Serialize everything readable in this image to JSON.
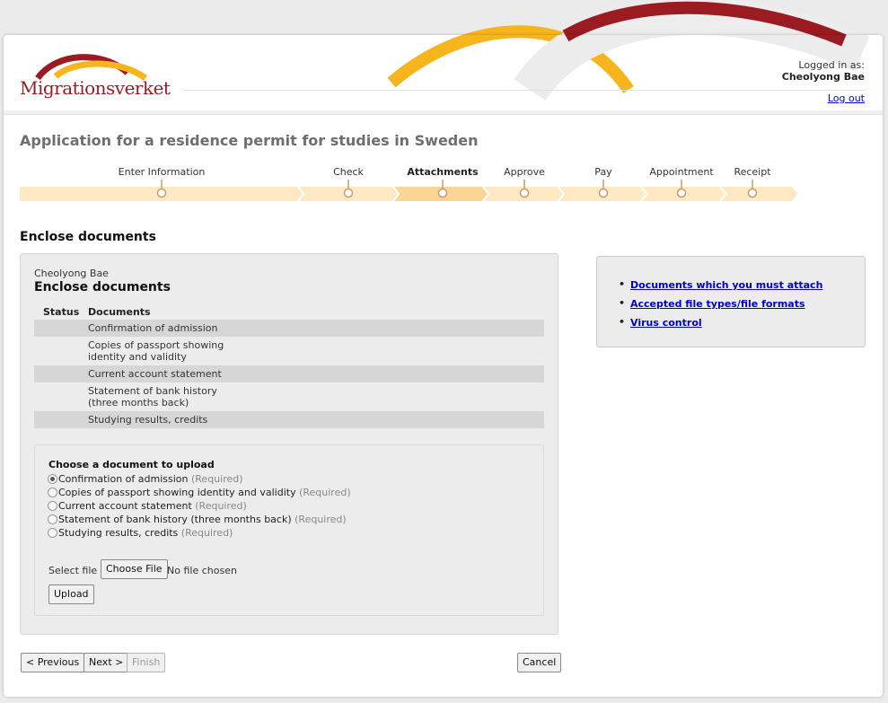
{
  "header": {
    "logo_text": "Migrationsverket",
    "logged_in_label": "Logged in as:",
    "user_name": "Cheolyong Bae",
    "logout_label": "Log out"
  },
  "colors": {
    "brand_red": "#9b1b22",
    "brand_yellow": "#f6b51d",
    "progress_track": "#fde9c3",
    "progress_active": "#f9d493",
    "link": "#0000cc"
  },
  "page_title": "Application for a residence permit for studies in Sweden",
  "progress": {
    "steps": [
      {
        "label": "Enter Information",
        "active": false
      },
      {
        "label": "Check",
        "active": false
      },
      {
        "label": "Attachments",
        "active": true
      },
      {
        "label": "Approve",
        "active": false
      },
      {
        "label": "Pay",
        "active": false
      },
      {
        "label": "Appointment",
        "active": false
      },
      {
        "label": "Receipt",
        "active": false
      }
    ]
  },
  "section_title": "Enclose documents",
  "panel": {
    "user_name": "Cheolyong Bae",
    "title": "Enclose documents",
    "table": {
      "headers": [
        "Status",
        "Documents"
      ],
      "rows": [
        {
          "status": "",
          "document_line1": "Confirmation of admission",
          "document_line2": ""
        },
        {
          "status": "",
          "document_line1": "Copies of passport showing",
          "document_line2": "identity and validity"
        },
        {
          "status": "",
          "document_line1": "Current account statement",
          "document_line2": ""
        },
        {
          "status": "",
          "document_line1": "Statement of bank history",
          "document_line2": "(three months back)"
        },
        {
          "status": "",
          "document_line1": "Studying results, credits",
          "document_line2": ""
        }
      ]
    },
    "upload": {
      "title": "Choose a document to upload",
      "options": [
        {
          "label": "Confirmation of admission",
          "note": "(Required)",
          "checked": true
        },
        {
          "label": "Copies of passport showing identity and validity",
          "note": "(Required)",
          "checked": false
        },
        {
          "label": "Current account statement",
          "note": "(Required)",
          "checked": false
        },
        {
          "label": "Statement of bank history (three months back)",
          "note": "(Required)",
          "checked": false
        },
        {
          "label": "Studying results, credits",
          "note": "(Required)",
          "checked": false
        }
      ],
      "select_file_label": "Select file",
      "choose_file_button": "Choose File",
      "no_file_text": "No file chosen",
      "upload_button": "Upload"
    }
  },
  "side_links": [
    "Documents which you must attach",
    "Accepted file types/file formats",
    "Virus control"
  ],
  "footer_buttons": {
    "previous": "< Previous",
    "next": "Next >",
    "finish": "Finish",
    "cancel": "Cancel"
  }
}
